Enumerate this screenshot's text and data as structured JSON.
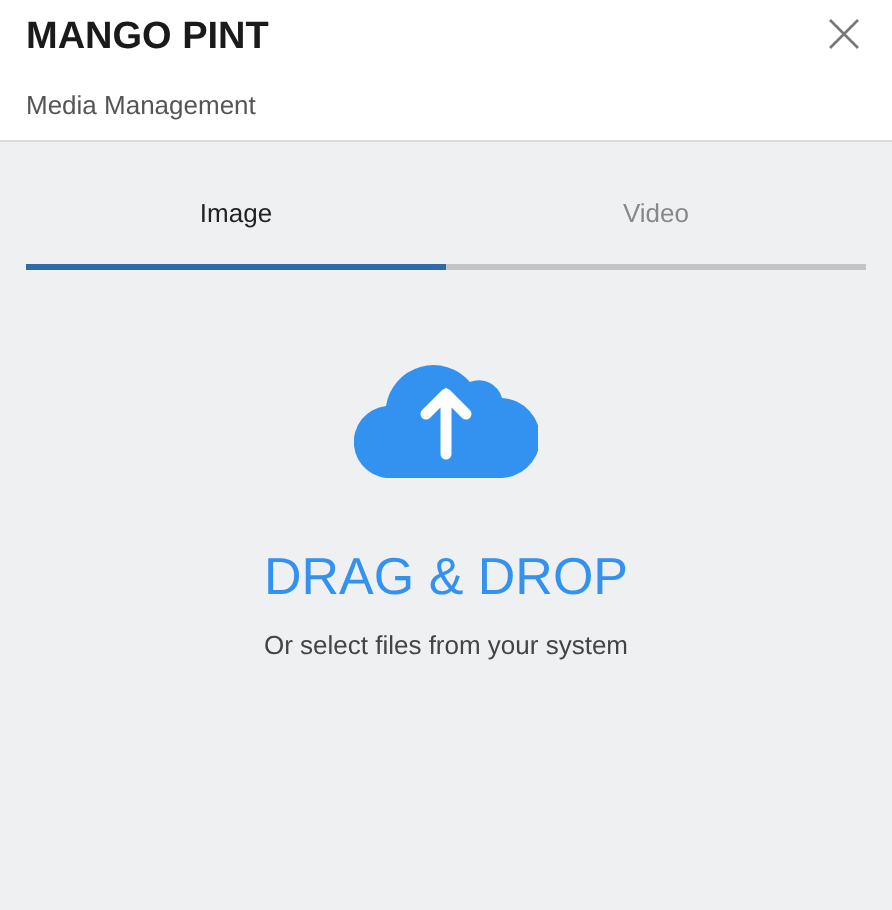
{
  "header": {
    "title": "MANGO PINT",
    "subtitle": "Media Management"
  },
  "tabs": [
    {
      "label": "Image",
      "selected": true
    },
    {
      "label": "Video",
      "selected": false
    }
  ],
  "dropzone": {
    "heading": "DRAG & DROP",
    "hint": "Or select files from your system"
  }
}
